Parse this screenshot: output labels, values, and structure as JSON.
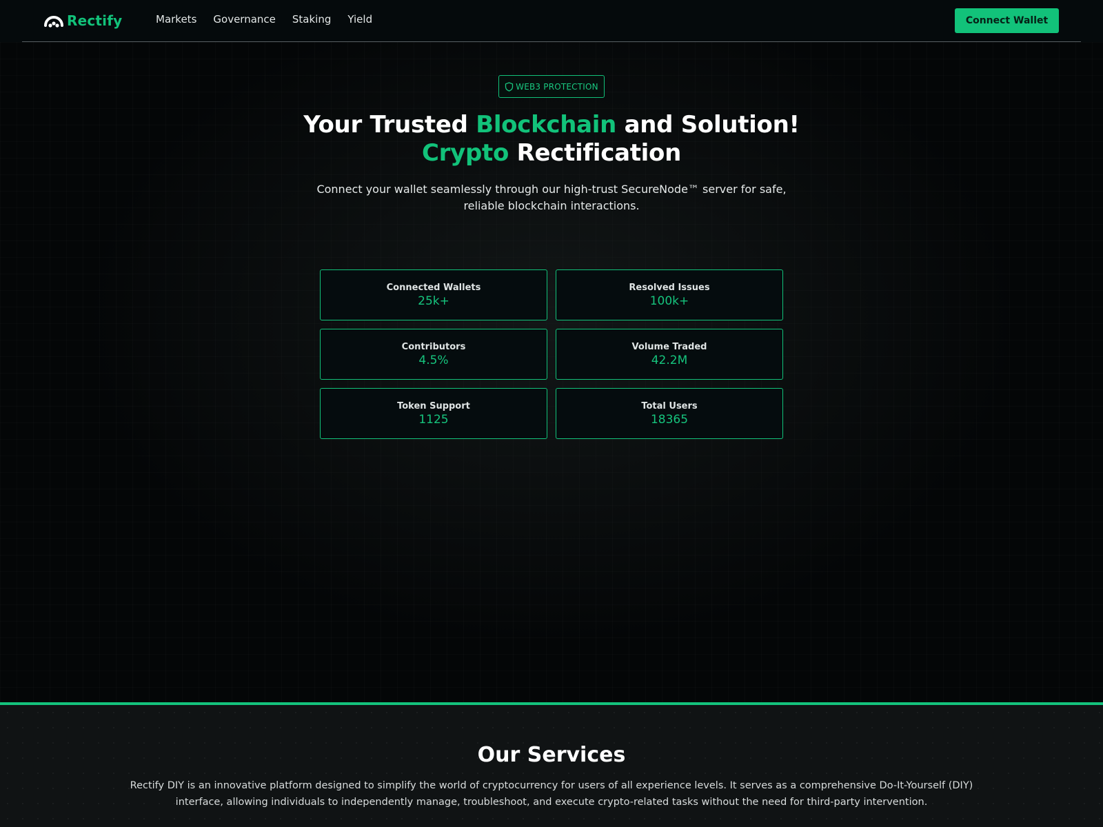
{
  "navbar": {
    "logo_text": "Rectify",
    "logo_icon": "rectify-logo-icon",
    "links": [
      "Markets",
      "Governance",
      "Staking",
      "Yield"
    ],
    "connect_button": "Connect Wallet"
  },
  "hero": {
    "badge": "WEB3 PROTECTION",
    "badge_icon": "shield-icon",
    "title": {
      "part1": "Your Trusted ",
      "accent1": "Blockchain",
      "part2": " and Solution!",
      "accent2": "Crypto",
      "part3": " Rectification"
    },
    "subtitle": "Connect your wallet seamlessly through our high-trust SecureNode™ server for safe, reliable blockchain interactions.",
    "stats": [
      {
        "label": "Connected Wallets",
        "value": "25k+"
      },
      {
        "label": "Resolved Issues",
        "value": "100k+"
      },
      {
        "label": "Contributors",
        "value": "4.5%"
      },
      {
        "label": "Volume Traded",
        "value": "42.2M"
      },
      {
        "label": "Token Support",
        "value": "1125"
      },
      {
        "label": "Total Users",
        "value": "18365"
      }
    ]
  },
  "services": {
    "title": "Our Services",
    "description": "Rectify DIY is an innovative platform designed to simplify the world of cryptocurrency for users of all experience levels. It serves as a comprehensive Do-It-Yourself (DIY) interface, allowing individuals to independently manage, troubleshoot, and execute crypto-related tasks without the need for third-party intervention."
  },
  "colors": {
    "accent": "#12c27a",
    "background": "#040607",
    "text": "#ffffff"
  }
}
